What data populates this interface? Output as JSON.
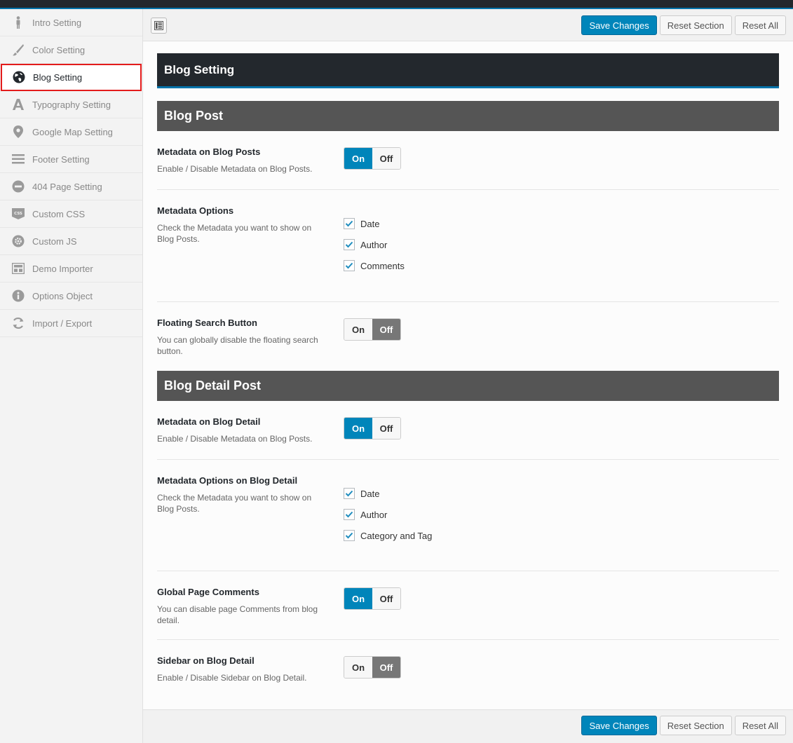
{
  "sidebar": {
    "items": [
      {
        "label": "Intro Setting",
        "icon": "person-icon"
      },
      {
        "label": "Color Setting",
        "icon": "brush-icon"
      },
      {
        "label": "Blog Setting",
        "icon": "globe-icon",
        "active": true
      },
      {
        "label": "Typography Setting",
        "icon": "typography-icon"
      },
      {
        "label": "Google Map Setting",
        "icon": "map-pin-icon"
      },
      {
        "label": "Footer Setting",
        "icon": "menu-lines-icon"
      },
      {
        "label": "404 Page Setting",
        "icon": "minus-circle-icon"
      },
      {
        "label": "Custom CSS",
        "icon": "css-badge-icon"
      },
      {
        "label": "Custom JS",
        "icon": "gear-circle-icon"
      },
      {
        "label": "Demo Importer",
        "icon": "layout-icon"
      },
      {
        "label": "Options Object",
        "icon": "info-icon"
      },
      {
        "label": "Import / Export",
        "icon": "refresh-icon"
      }
    ]
  },
  "toolbar": {
    "save_label": "Save Changes",
    "reset_section_label": "Reset Section",
    "reset_all_label": "Reset All"
  },
  "section_title": "Blog Setting",
  "groups": {
    "blog_post": {
      "title": "Blog Post",
      "metadata": {
        "title": "Metadata on Blog Posts",
        "desc": "Enable / Disable Metadata on Blog Posts.",
        "on": "On",
        "off": "Off",
        "state": "on"
      },
      "metadata_options": {
        "title": "Metadata Options",
        "desc": "Check the Metadata you want to show on Blog Posts.",
        "options": [
          {
            "label": "Date",
            "checked": true
          },
          {
            "label": "Author",
            "checked": true
          },
          {
            "label": "Comments",
            "checked": true
          }
        ]
      },
      "floating_search": {
        "title": "Floating Search Button",
        "desc": "You can globally disable the floating search button.",
        "on": "On",
        "off": "Off",
        "state": "off"
      }
    },
    "blog_detail": {
      "title": "Blog Detail Post",
      "metadata": {
        "title": "Metadata on Blog Detail",
        "desc": "Enable / Disable Metadata on Blog Posts.",
        "on": "On",
        "off": "Off",
        "state": "on"
      },
      "metadata_options": {
        "title": "Metadata Options on Blog Detail",
        "desc": "Check the Metadata you want to show on Blog Posts.",
        "options": [
          {
            "label": "Date",
            "checked": true
          },
          {
            "label": "Author",
            "checked": true
          },
          {
            "label": "Category and Tag",
            "checked": true
          }
        ]
      },
      "page_comments": {
        "title": "Global Page Comments",
        "desc": "You can disable page Comments from blog detail.",
        "on": "On",
        "off": "Off",
        "state": "on"
      },
      "sidebar": {
        "title": "Sidebar on Blog Detail",
        "desc": "Enable / Disable Sidebar on Blog Detail.",
        "on": "On",
        "off": "Off",
        "state": "off"
      }
    }
  },
  "colors": {
    "accent": "#0085ba",
    "header_dark": "#23282d",
    "group_header": "#555555",
    "active_outline": "#e31b1b"
  }
}
